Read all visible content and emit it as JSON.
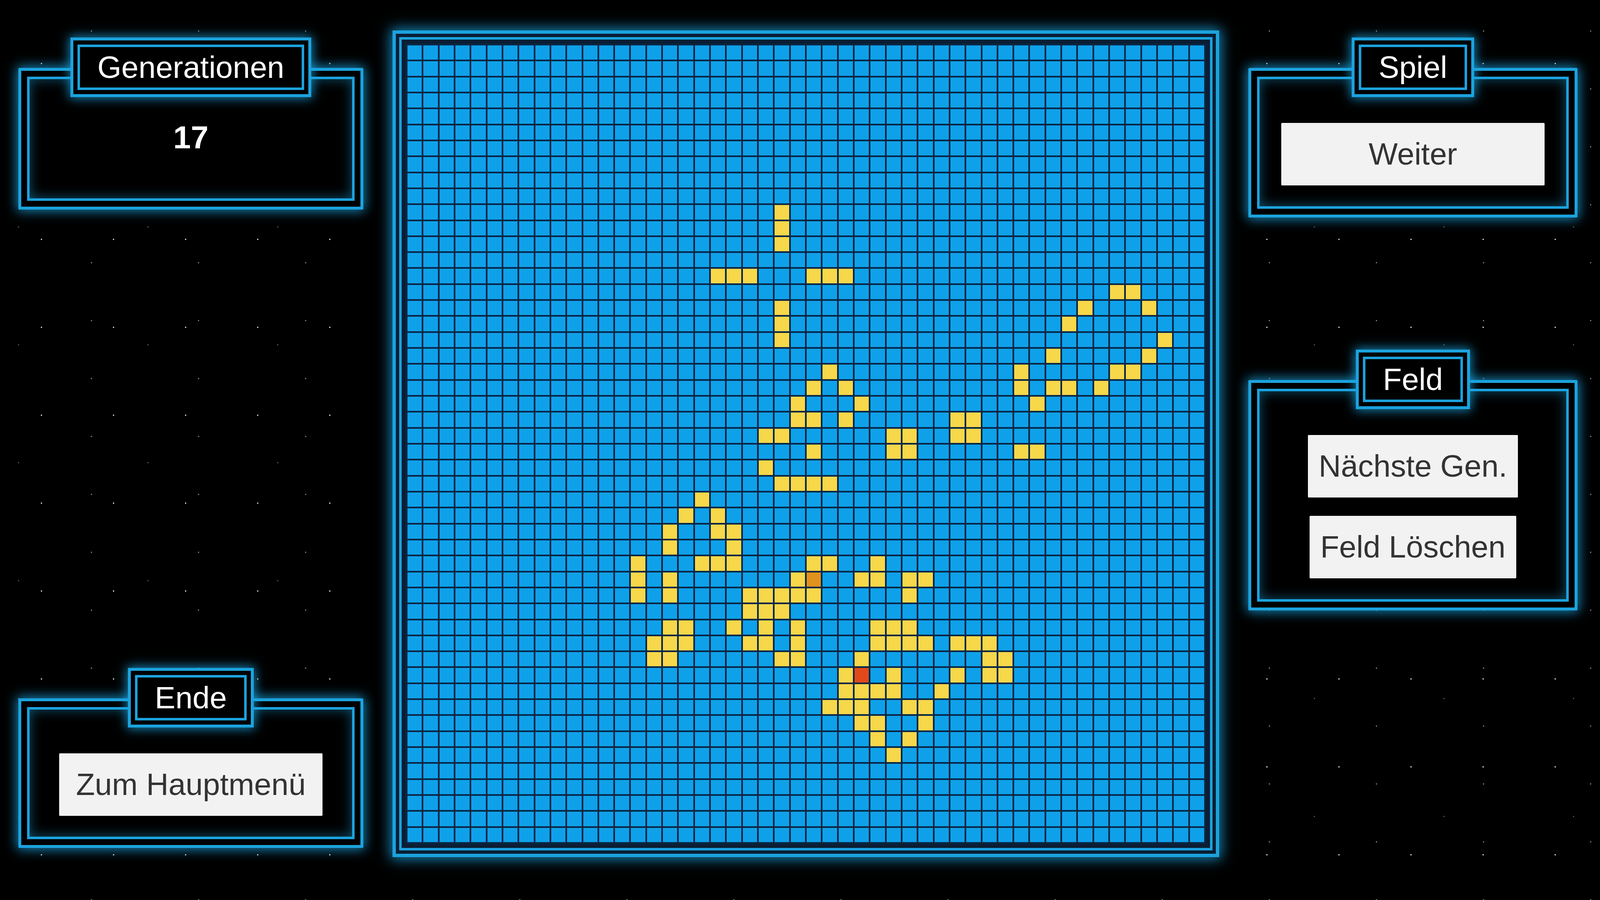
{
  "panels": {
    "generations": {
      "title": "Generationen",
      "value": "17"
    },
    "end": {
      "title": "Ende",
      "buttons": [
        "Zum Hauptmenü"
      ]
    },
    "game": {
      "title": "Spiel",
      "buttons": [
        "Weiter"
      ]
    },
    "field": {
      "title": "Feld",
      "buttons": [
        "Nächste Gen.",
        "Feld Löschen"
      ]
    }
  },
  "grid": {
    "rows": 50,
    "cols": 50,
    "cells": [
      {
        "row": 10,
        "col": 23,
        "color": "#f7d84a"
      },
      {
        "row": 11,
        "col": 23,
        "color": "#f7d84a"
      },
      {
        "row": 12,
        "col": 23,
        "color": "#f7d84a"
      },
      {
        "row": 14,
        "col": 19,
        "color": "#f7d84a"
      },
      {
        "row": 14,
        "col": 20,
        "color": "#f7d84a"
      },
      {
        "row": 14,
        "col": 21,
        "color": "#f7d84a"
      },
      {
        "row": 14,
        "col": 25,
        "color": "#f7d84a"
      },
      {
        "row": 14,
        "col": 26,
        "color": "#f7d84a"
      },
      {
        "row": 14,
        "col": 27,
        "color": "#f7d84a"
      },
      {
        "row": 15,
        "col": 44,
        "color": "#f7d84a"
      },
      {
        "row": 15,
        "col": 45,
        "color": "#f7d84a"
      },
      {
        "row": 16,
        "col": 23,
        "color": "#f7d84a"
      },
      {
        "row": 16,
        "col": 42,
        "color": "#f7d84a"
      },
      {
        "row": 16,
        "col": 46,
        "color": "#f7d84a"
      },
      {
        "row": 17,
        "col": 23,
        "color": "#f7d84a"
      },
      {
        "row": 17,
        "col": 41,
        "color": "#f7d84a"
      },
      {
        "row": 18,
        "col": 23,
        "color": "#f7d84a"
      },
      {
        "row": 18,
        "col": 47,
        "color": "#f7d84a"
      },
      {
        "row": 19,
        "col": 40,
        "color": "#f7d84a"
      },
      {
        "row": 19,
        "col": 46,
        "color": "#f7d84a"
      },
      {
        "row": 20,
        "col": 26,
        "color": "#f7d84a"
      },
      {
        "row": 20,
        "col": 38,
        "color": "#f7d84a"
      },
      {
        "row": 20,
        "col": 44,
        "color": "#f7d84a"
      },
      {
        "row": 20,
        "col": 45,
        "color": "#f7d84a"
      },
      {
        "row": 21,
        "col": 25,
        "color": "#f7d84a"
      },
      {
        "row": 21,
        "col": 27,
        "color": "#f7d84a"
      },
      {
        "row": 21,
        "col": 38,
        "color": "#f7d84a"
      },
      {
        "row": 21,
        "col": 40,
        "color": "#f7d84a"
      },
      {
        "row": 21,
        "col": 41,
        "color": "#f7d84a"
      },
      {
        "row": 21,
        "col": 43,
        "color": "#f7d84a"
      },
      {
        "row": 22,
        "col": 24,
        "color": "#f7d84a"
      },
      {
        "row": 22,
        "col": 28,
        "color": "#f7d84a"
      },
      {
        "row": 22,
        "col": 39,
        "color": "#f7d84a"
      },
      {
        "row": 23,
        "col": 24,
        "color": "#f7d84a"
      },
      {
        "row": 23,
        "col": 25,
        "color": "#f7d84a"
      },
      {
        "row": 23,
        "col": 27,
        "color": "#f7d84a"
      },
      {
        "row": 23,
        "col": 34,
        "color": "#f7d84a"
      },
      {
        "row": 23,
        "col": 35,
        "color": "#f7d84a"
      },
      {
        "row": 24,
        "col": 22,
        "color": "#f7d84a"
      },
      {
        "row": 24,
        "col": 23,
        "color": "#f7d84a"
      },
      {
        "row": 24,
        "col": 30,
        "color": "#f7d84a"
      },
      {
        "row": 24,
        "col": 31,
        "color": "#f7d84a"
      },
      {
        "row": 24,
        "col": 34,
        "color": "#f7d84a"
      },
      {
        "row": 24,
        "col": 35,
        "color": "#f7d84a"
      },
      {
        "row": 25,
        "col": 25,
        "color": "#f7d84a"
      },
      {
        "row": 25,
        "col": 30,
        "color": "#f7d84a"
      },
      {
        "row": 25,
        "col": 31,
        "color": "#f7d84a"
      },
      {
        "row": 25,
        "col": 38,
        "color": "#f7d84a"
      },
      {
        "row": 25,
        "col": 39,
        "color": "#f7d84a"
      },
      {
        "row": 26,
        "col": 22,
        "color": "#f7d84a"
      },
      {
        "row": 27,
        "col": 23,
        "color": "#f7d84a"
      },
      {
        "row": 27,
        "col": 24,
        "color": "#f7d84a"
      },
      {
        "row": 27,
        "col": 25,
        "color": "#f7d84a"
      },
      {
        "row": 27,
        "col": 26,
        "color": "#f7d84a"
      },
      {
        "row": 28,
        "col": 18,
        "color": "#f7d84a"
      },
      {
        "row": 29,
        "col": 17,
        "color": "#f7d84a"
      },
      {
        "row": 29,
        "col": 19,
        "color": "#f7d84a"
      },
      {
        "row": 30,
        "col": 16,
        "color": "#f7d84a"
      },
      {
        "row": 30,
        "col": 19,
        "color": "#f7d84a"
      },
      {
        "row": 30,
        "col": 20,
        "color": "#f7d84a"
      },
      {
        "row": 31,
        "col": 16,
        "color": "#f7d84a"
      },
      {
        "row": 31,
        "col": 20,
        "color": "#f7d84a"
      },
      {
        "row": 32,
        "col": 14,
        "color": "#f7d84a"
      },
      {
        "row": 32,
        "col": 18,
        "color": "#f7d84a"
      },
      {
        "row": 32,
        "col": 19,
        "color": "#f7d84a"
      },
      {
        "row": 32,
        "col": 20,
        "color": "#f7d84a"
      },
      {
        "row": 32,
        "col": 25,
        "color": "#f7d84a"
      },
      {
        "row": 32,
        "col": 26,
        "color": "#f7d84a"
      },
      {
        "row": 32,
        "col": 29,
        "color": "#f7d84a"
      },
      {
        "row": 33,
        "col": 14,
        "color": "#f7d84a"
      },
      {
        "row": 33,
        "col": 16,
        "color": "#f7d84a"
      },
      {
        "row": 33,
        "col": 24,
        "color": "#f7d84a"
      },
      {
        "row": 33,
        "col": 25,
        "color": "#e0921c"
      },
      {
        "row": 33,
        "col": 28,
        "color": "#f7d84a"
      },
      {
        "row": 33,
        "col": 29,
        "color": "#f7d84a"
      },
      {
        "row": 33,
        "col": 31,
        "color": "#f7d84a"
      },
      {
        "row": 33,
        "col": 32,
        "color": "#f7d84a"
      },
      {
        "row": 34,
        "col": 14,
        "color": "#f7d84a"
      },
      {
        "row": 34,
        "col": 16,
        "color": "#f7d84a"
      },
      {
        "row": 34,
        "col": 21,
        "color": "#f7d84a"
      },
      {
        "row": 34,
        "col": 22,
        "color": "#f7d84a"
      },
      {
        "row": 34,
        "col": 23,
        "color": "#f7d84a"
      },
      {
        "row": 34,
        "col": 24,
        "color": "#f7d84a"
      },
      {
        "row": 34,
        "col": 25,
        "color": "#f7d84a"
      },
      {
        "row": 34,
        "col": 31,
        "color": "#f7d84a"
      },
      {
        "row": 35,
        "col": 21,
        "color": "#f7d84a"
      },
      {
        "row": 35,
        "col": 22,
        "color": "#f7d84a"
      },
      {
        "row": 35,
        "col": 23,
        "color": "#f7d84a"
      },
      {
        "row": 36,
        "col": 16,
        "color": "#f7d84a"
      },
      {
        "row": 36,
        "col": 17,
        "color": "#f7d84a"
      },
      {
        "row": 36,
        "col": 20,
        "color": "#f7d84a"
      },
      {
        "row": 36,
        "col": 22,
        "color": "#f7d84a"
      },
      {
        "row": 36,
        "col": 24,
        "color": "#f7d84a"
      },
      {
        "row": 36,
        "col": 29,
        "color": "#f7d84a"
      },
      {
        "row": 36,
        "col": 30,
        "color": "#f7d84a"
      },
      {
        "row": 36,
        "col": 31,
        "color": "#f7d84a"
      },
      {
        "row": 37,
        "col": 15,
        "color": "#f7d84a"
      },
      {
        "row": 37,
        "col": 16,
        "color": "#f7d84a"
      },
      {
        "row": 37,
        "col": 17,
        "color": "#f7d84a"
      },
      {
        "row": 37,
        "col": 21,
        "color": "#f7d84a"
      },
      {
        "row": 37,
        "col": 22,
        "color": "#f7d84a"
      },
      {
        "row": 37,
        "col": 24,
        "color": "#f7d84a"
      },
      {
        "row": 37,
        "col": 29,
        "color": "#f7d84a"
      },
      {
        "row": 37,
        "col": 30,
        "color": "#f7d84a"
      },
      {
        "row": 37,
        "col": 31,
        "color": "#f7d84a"
      },
      {
        "row": 37,
        "col": 32,
        "color": "#f7d84a"
      },
      {
        "row": 37,
        "col": 34,
        "color": "#f7d84a"
      },
      {
        "row": 37,
        "col": 35,
        "color": "#f7d84a"
      },
      {
        "row": 37,
        "col": 36,
        "color": "#f7d84a"
      },
      {
        "row": 38,
        "col": 15,
        "color": "#f7d84a"
      },
      {
        "row": 38,
        "col": 16,
        "color": "#f7d84a"
      },
      {
        "row": 38,
        "col": 23,
        "color": "#f7d84a"
      },
      {
        "row": 38,
        "col": 24,
        "color": "#f7d84a"
      },
      {
        "row": 38,
        "col": 28,
        "color": "#f7d84a"
      },
      {
        "row": 38,
        "col": 36,
        "color": "#f7d84a"
      },
      {
        "row": 38,
        "col": 37,
        "color": "#f7d84a"
      },
      {
        "row": 39,
        "col": 27,
        "color": "#f7d84a"
      },
      {
        "row": 39,
        "col": 28,
        "color": "#e04a1a"
      },
      {
        "row": 39,
        "col": 30,
        "color": "#f7d84a"
      },
      {
        "row": 39,
        "col": 34,
        "color": "#f7d84a"
      },
      {
        "row": 39,
        "col": 36,
        "color": "#f7d84a"
      },
      {
        "row": 39,
        "col": 37,
        "color": "#f7d84a"
      },
      {
        "row": 40,
        "col": 27,
        "color": "#f7d84a"
      },
      {
        "row": 40,
        "col": 28,
        "color": "#f7d84a"
      },
      {
        "row": 40,
        "col": 29,
        "color": "#f7d84a"
      },
      {
        "row": 40,
        "col": 30,
        "color": "#f7d84a"
      },
      {
        "row": 40,
        "col": 33,
        "color": "#f7d84a"
      },
      {
        "row": 41,
        "col": 26,
        "color": "#f7d84a"
      },
      {
        "row": 41,
        "col": 27,
        "color": "#f7d84a"
      },
      {
        "row": 41,
        "col": 28,
        "color": "#f7d84a"
      },
      {
        "row": 41,
        "col": 31,
        "color": "#f7d84a"
      },
      {
        "row": 41,
        "col": 32,
        "color": "#f7d84a"
      },
      {
        "row": 42,
        "col": 28,
        "color": "#f7d84a"
      },
      {
        "row": 42,
        "col": 29,
        "color": "#f7d84a"
      },
      {
        "row": 42,
        "col": 32,
        "color": "#f7d84a"
      },
      {
        "row": 43,
        "col": 29,
        "color": "#f7d84a"
      },
      {
        "row": 43,
        "col": 31,
        "color": "#f7d84a"
      },
      {
        "row": 44,
        "col": 30,
        "color": "#f7d84a"
      }
    ]
  }
}
